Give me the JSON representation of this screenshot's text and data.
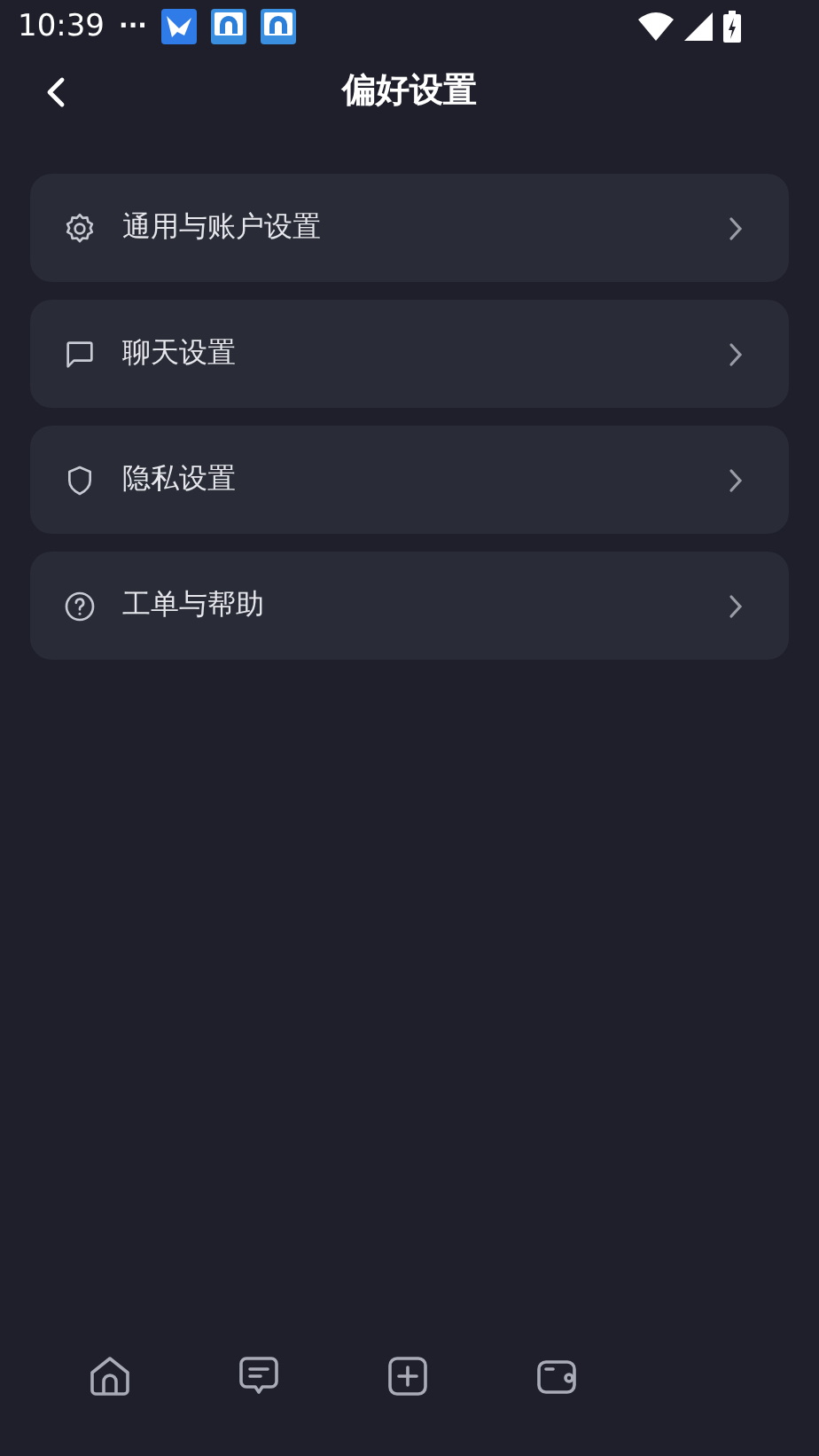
{
  "status_bar": {
    "time": "10:39",
    "more": "···"
  },
  "header": {
    "title": "偏好设置"
  },
  "menu": [
    {
      "kind": "gear",
      "label": "通用与账户设置"
    },
    {
      "kind": "chat",
      "label": "聊天设置"
    },
    {
      "kind": "shield",
      "label": "隐私设置"
    },
    {
      "kind": "help",
      "label": "工单与帮助"
    }
  ],
  "bottom_nav": [
    {
      "kind": "home"
    },
    {
      "kind": "message"
    },
    {
      "kind": "add"
    },
    {
      "kind": "wallet"
    }
  ]
}
